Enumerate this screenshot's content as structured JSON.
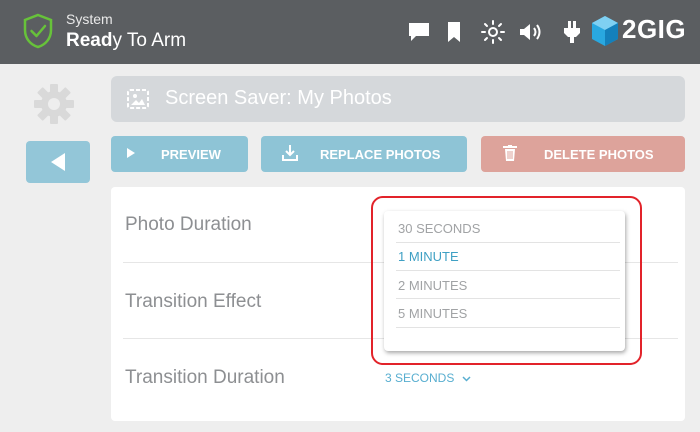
{
  "status": {
    "line1": "System",
    "line2_bold": "Read",
    "line2_rest": "y To Arm",
    "brand": "2GIG",
    "icons": [
      "message-icon",
      "bookmark-icon",
      "brightness-icon",
      "volume-icon",
      "power-plug-icon"
    ]
  },
  "screen": {
    "title": "Screen Saver: My Photos"
  },
  "toolbar": {
    "preview_label": "PREVIEW",
    "replace_label": "REPLACE PHOTOS",
    "delete_label": "DELETE PHOTOS"
  },
  "settings": {
    "photo_duration_label": "Photo Duration",
    "transition_effect_label": "Transition Effect",
    "transition_duration_label": "Transition Duration",
    "transition_duration_value": "3 SECONDS"
  },
  "dropdown": {
    "options": [
      "30 SECONDS",
      "1 MINUTE",
      "2 MINUTES",
      "5 MINUTES"
    ],
    "selected": "1 MINUTE"
  },
  "colors": {
    "topbar": "#5b5e61",
    "accent_blue": "#8ec4d6",
    "delete_red": "#dda39b",
    "highlight_red": "#e2232a"
  }
}
